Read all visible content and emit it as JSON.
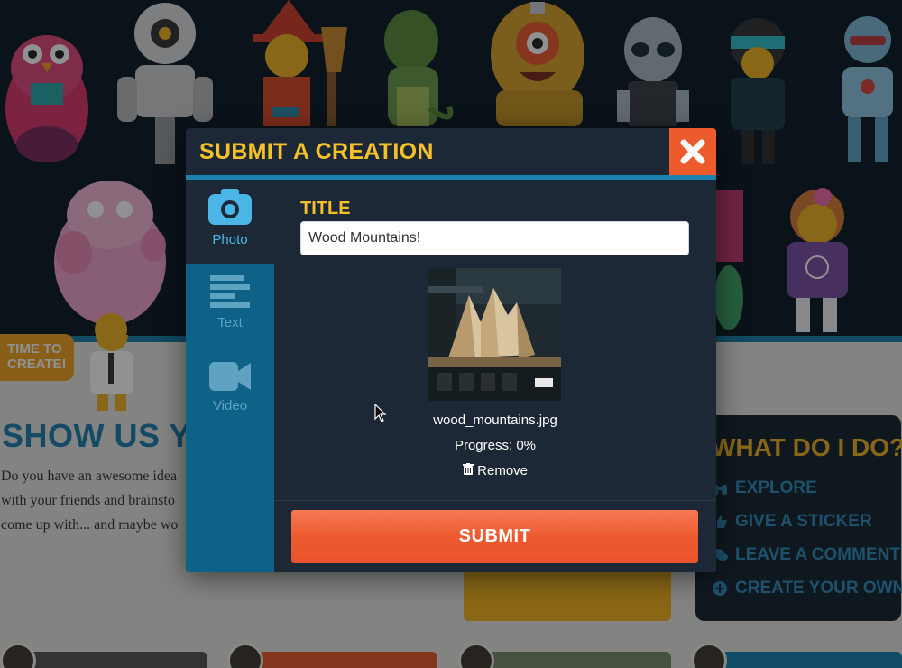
{
  "page": {
    "badge": {
      "line1": "TIME TO",
      "line2": "CREATE!"
    },
    "heading": "SHOW US YOUR",
    "paragraph_lines": [
      "Do you have an awesome idea",
      "with your friends and brainsto",
      "come up with... and maybe wo"
    ],
    "what_do_i_do": {
      "title": "WHAT DO I DO?",
      "items": [
        {
          "icon": "binoculars-icon",
          "label": "EXPLORE"
        },
        {
          "icon": "thumbs-up-icon",
          "label": "GIVE A STICKER"
        },
        {
          "icon": "chat-bubbles-icon",
          "label": "LEAVE A COMMENT"
        },
        {
          "icon": "plus-circle-icon",
          "label": "CREATE YOUR OWN"
        }
      ]
    }
  },
  "modal": {
    "title": "SUBMIT A CREATION",
    "close_icon": "close-x-icon",
    "tabs": [
      {
        "label": "Photo",
        "icon": "camera-icon",
        "active": true
      },
      {
        "label": "Text",
        "icon": "text-lines-icon",
        "active": false
      },
      {
        "label": "Video",
        "icon": "video-camera-icon",
        "active": false
      }
    ],
    "title_field": {
      "label": "TITLE",
      "value": "Wood Mountains!"
    },
    "upload": {
      "file_name": "wood_mountains.jpg",
      "progress": "Progress: 0%",
      "remove_label": "Remove",
      "remove_icon": "trash-icon"
    },
    "submit_label": "SUBMIT"
  },
  "colors": {
    "accent_yellow": "#f5c02a",
    "accent_orange": "#ee5a2b",
    "accent_blue": "#1d82ad",
    "modal_bg": "#1d2836"
  }
}
